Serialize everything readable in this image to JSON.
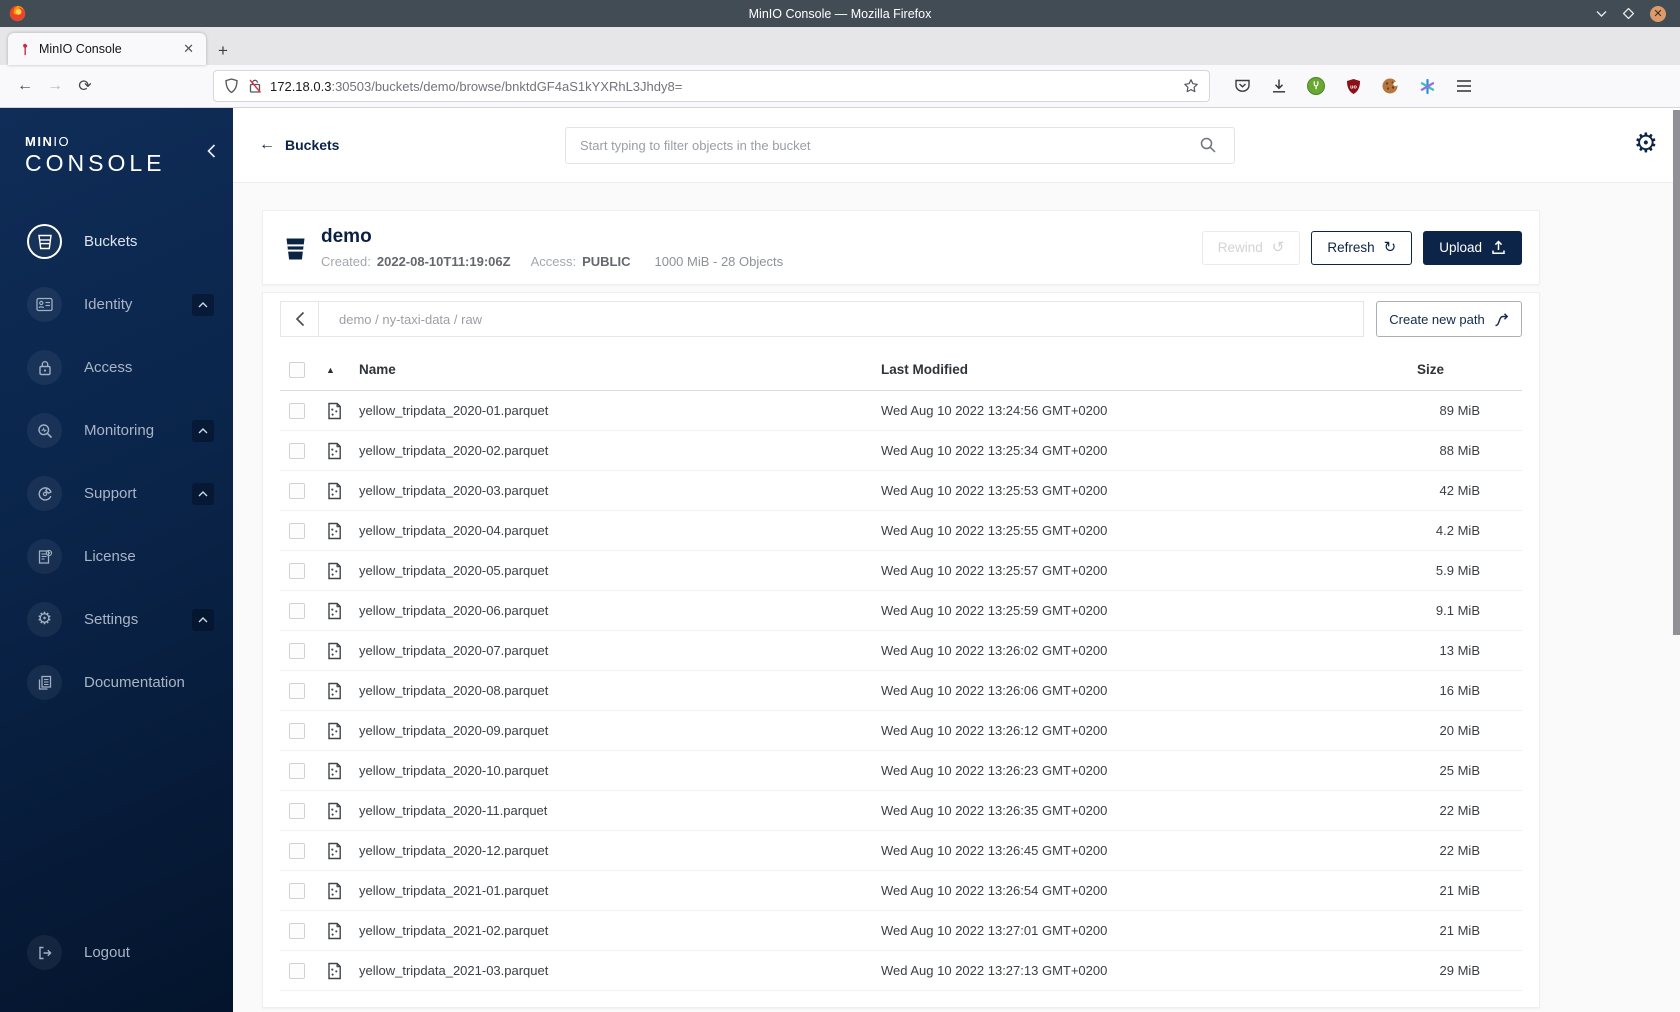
{
  "browser": {
    "window_title": "MinIO Console — Mozilla Firefox",
    "tab_title": "MinIO Console",
    "new_tab_label": "+",
    "url_host": "172.18.0.3",
    "url_rest": ":30503/buckets/demo/browse/bnktdGF4aS1kYXRhL3Jhdy8=",
    "toolbar_icons": [
      "pocket-icon",
      "download-icon",
      "privacy-badger-icon",
      "ublock-origin-icon",
      "cookie-icon",
      "container-icon",
      "menu-icon"
    ]
  },
  "sidebar": {
    "logo_top_bold": "MIN",
    "logo_top_thin": "IO",
    "logo_bottom": "CONSOLE",
    "items": [
      {
        "label": "Buckets",
        "icon": "bucket-icon",
        "active": true,
        "expandable": false
      },
      {
        "label": "Identity",
        "icon": "identity-icon",
        "active": false,
        "expandable": true
      },
      {
        "label": "Access",
        "icon": "access-icon",
        "active": false,
        "expandable": false
      },
      {
        "label": "Monitoring",
        "icon": "monitoring-icon",
        "active": false,
        "expandable": true
      },
      {
        "label": "Support",
        "icon": "support-icon",
        "active": false,
        "expandable": true
      },
      {
        "label": "License",
        "icon": "license-icon",
        "active": false,
        "expandable": false
      },
      {
        "label": "Settings",
        "icon": "settings-icon",
        "active": false,
        "expandable": true
      },
      {
        "label": "Documentation",
        "icon": "documentation-icon",
        "active": false,
        "expandable": false
      }
    ],
    "logout_label": "Logout"
  },
  "topbar": {
    "back_label": "Buckets",
    "search_placeholder": "Start typing to filter objects in the bucket"
  },
  "bucket": {
    "name": "demo",
    "created_label": "Created:",
    "created_value": "2022-08-10T11:19:06Z",
    "access_label": "Access:",
    "access_value": "PUBLIC",
    "summary": "1000 MiB - 28 Objects",
    "rewind_label": "Rewind",
    "refresh_label": "Refresh",
    "upload_label": "Upload"
  },
  "path_bar": {
    "path": "demo / ny-taxi-data / raw",
    "create_button": "Create new path"
  },
  "table": {
    "columns": {
      "name": "Name",
      "modified": "Last Modified",
      "size": "Size"
    },
    "rows": [
      {
        "name": "yellow_tripdata_2020-01.parquet",
        "modified": "Wed Aug 10 2022 13:24:56 GMT+0200",
        "size": "89 MiB"
      },
      {
        "name": "yellow_tripdata_2020-02.parquet",
        "modified": "Wed Aug 10 2022 13:25:34 GMT+0200",
        "size": "88 MiB"
      },
      {
        "name": "yellow_tripdata_2020-03.parquet",
        "modified": "Wed Aug 10 2022 13:25:53 GMT+0200",
        "size": "42 MiB"
      },
      {
        "name": "yellow_tripdata_2020-04.parquet",
        "modified": "Wed Aug 10 2022 13:25:55 GMT+0200",
        "size": "4.2 MiB"
      },
      {
        "name": "yellow_tripdata_2020-05.parquet",
        "modified": "Wed Aug 10 2022 13:25:57 GMT+0200",
        "size": "5.9 MiB"
      },
      {
        "name": "yellow_tripdata_2020-06.parquet",
        "modified": "Wed Aug 10 2022 13:25:59 GMT+0200",
        "size": "9.1 MiB"
      },
      {
        "name": "yellow_tripdata_2020-07.parquet",
        "modified": "Wed Aug 10 2022 13:26:02 GMT+0200",
        "size": "13 MiB"
      },
      {
        "name": "yellow_tripdata_2020-08.parquet",
        "modified": "Wed Aug 10 2022 13:26:06 GMT+0200",
        "size": "16 MiB"
      },
      {
        "name": "yellow_tripdata_2020-09.parquet",
        "modified": "Wed Aug 10 2022 13:26:12 GMT+0200",
        "size": "20 MiB"
      },
      {
        "name": "yellow_tripdata_2020-10.parquet",
        "modified": "Wed Aug 10 2022 13:26:23 GMT+0200",
        "size": "25 MiB"
      },
      {
        "name": "yellow_tripdata_2020-11.parquet",
        "modified": "Wed Aug 10 2022 13:26:35 GMT+0200",
        "size": "22 MiB"
      },
      {
        "name": "yellow_tripdata_2020-12.parquet",
        "modified": "Wed Aug 10 2022 13:26:45 GMT+0200",
        "size": "22 MiB"
      },
      {
        "name": "yellow_tripdata_2021-01.parquet",
        "modified": "Wed Aug 10 2022 13:26:54 GMT+0200",
        "size": "21 MiB"
      },
      {
        "name": "yellow_tripdata_2021-02.parquet",
        "modified": "Wed Aug 10 2022 13:27:01 GMT+0200",
        "size": "21 MiB"
      },
      {
        "name": "yellow_tripdata_2021-03.parquet",
        "modified": "Wed Aug 10 2022 13:27:13 GMT+0200",
        "size": "29 MiB"
      }
    ]
  },
  "colors": {
    "primary_navy": "#0c2447",
    "sidebar_gradient_start": "#0f2d58",
    "sidebar_gradient_end": "#04142c",
    "titlebar": "#424c55",
    "page_bg": "#fafafa"
  }
}
